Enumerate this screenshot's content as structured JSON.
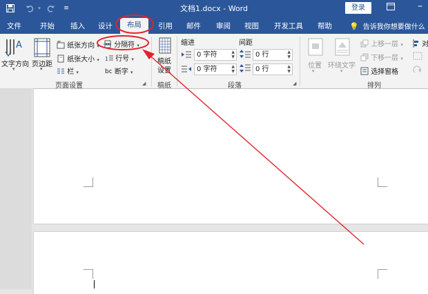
{
  "titlebar": {
    "doc_title": "文档1.docx  -  Word",
    "login_label": "登录",
    "save_icon": "save-icon",
    "undo_icon": "undo-icon",
    "redo_icon": "redo-icon",
    "customize_icon": "customize-quick-access-icon"
  },
  "tabs": {
    "file": "文件",
    "home": "开始",
    "insert": "插入",
    "design": "设计",
    "layout": "布局",
    "references": "引用",
    "mailings": "邮件",
    "review": "审阅",
    "view": "视图",
    "developer": "开发工具",
    "help": "帮助",
    "tell_me": "告诉我你想要做什么"
  },
  "ribbon": {
    "page_setup": {
      "text_direction": "文字方向",
      "margins": "页边距",
      "orientation": "纸张方向",
      "size": "纸张大小",
      "columns": "栏",
      "breaks": "分隔符",
      "line_numbers": "行号",
      "hyphenation": "断字",
      "group_label": "页面设置"
    },
    "manuscript": {
      "line1": "稿纸",
      "line2": "设置",
      "group_label": "稿纸"
    },
    "paragraph": {
      "indent_label": "缩进",
      "spacing_label": "间距",
      "indent_left": "0 字符",
      "indent_right": "0 字符",
      "spacing_before": "0 行",
      "spacing_after": "0 行",
      "group_label": "段落"
    },
    "arrange": {
      "position": "位置",
      "wrap_text": "环绕文字",
      "bring_forward": "上移一层",
      "send_backward": "下移一层",
      "selection_pane": "选择窗格",
      "align": "对",
      "group_label": "排列"
    }
  },
  "colors": {
    "word_blue": "#2b579a",
    "annotation_red": "#e0242c"
  }
}
